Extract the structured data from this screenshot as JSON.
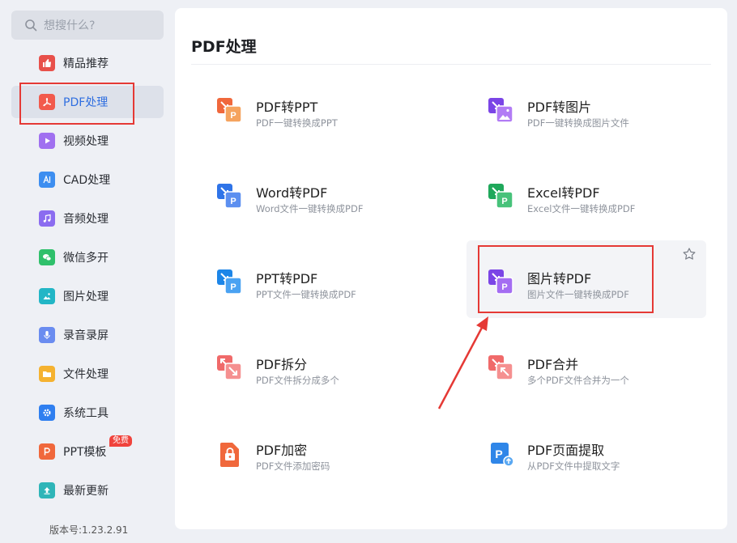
{
  "search": {
    "placeholder": "想搜什么?"
  },
  "sidebar": {
    "items": [
      {
        "label": "精品推荐",
        "icon": "thumbs-up-icon",
        "color": "#e8504a"
      },
      {
        "label": "PDF处理",
        "icon": "pdf-icon",
        "color": "#f25a4c"
      },
      {
        "label": "视频处理",
        "icon": "play-icon",
        "color": "#a070f0"
      },
      {
        "label": "CAD处理",
        "icon": "cad-icon",
        "color": "#3d8ef0"
      },
      {
        "label": "音频处理",
        "icon": "music-icon",
        "color": "#8b6cf0"
      },
      {
        "label": "微信多开",
        "icon": "wechat-icon",
        "color": "#2fc06b"
      },
      {
        "label": "图片处理",
        "icon": "image-icon",
        "color": "#22b6c6"
      },
      {
        "label": "录音录屏",
        "icon": "mic-icon",
        "color": "#6a8cf0"
      },
      {
        "label": "文件处理",
        "icon": "folder-icon",
        "color": "#f5b230"
      },
      {
        "label": "系统工具",
        "icon": "gear-icon",
        "color": "#2f7ff0"
      },
      {
        "label": "PPT模板",
        "icon": "ppt-icon",
        "color": "#f0683c"
      },
      {
        "label": "最新更新",
        "icon": "upload-icon",
        "color": "#2fb5b8"
      }
    ],
    "badge": "免费",
    "version": "版本号:1.23.2.91"
  },
  "panel": {
    "title": "PDF处理",
    "tools": [
      {
        "title": "PDF转PPT",
        "desc": "PDF一键转换成PPT",
        "icon": "pdf-to-ppt-icon"
      },
      {
        "title": "PDF转图片",
        "desc": "PDF一键转换成图片文件",
        "icon": "pdf-to-image-icon"
      },
      {
        "title": "Word转PDF",
        "desc": "Word文件一键转换成PDF",
        "icon": "word-to-pdf-icon"
      },
      {
        "title": "Excel转PDF",
        "desc": "Excel文件一键转换成PDF",
        "icon": "excel-to-pdf-icon"
      },
      {
        "title": "PPT转PDF",
        "desc": "PPT文件一键转换成PDF",
        "icon": "ppt-to-pdf-icon"
      },
      {
        "title": "图片转PDF",
        "desc": "图片文件一键转换成PDF",
        "icon": "image-to-pdf-icon"
      },
      {
        "title": "PDF拆分",
        "desc": "PDF文件拆分成多个",
        "icon": "pdf-split-icon"
      },
      {
        "title": "PDF合并",
        "desc": "多个PDF文件合并为一个",
        "icon": "pdf-merge-icon"
      },
      {
        "title": "PDF加密",
        "desc": "PDF文件添加密码",
        "icon": "pdf-encrypt-icon"
      },
      {
        "title": "PDF页面提取",
        "desc": "从PDF文件中提取文字",
        "icon": "pdf-extract-icon"
      }
    ]
  },
  "colors": {
    "accent": "#2f6ee0",
    "annotation": "#e53935"
  }
}
